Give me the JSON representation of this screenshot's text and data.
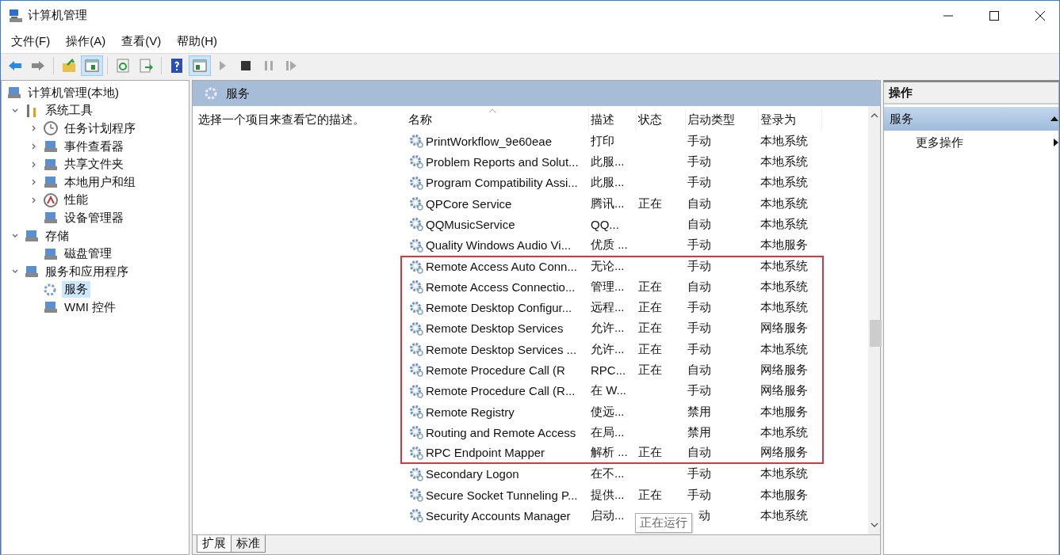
{
  "window": {
    "title": "计算机管理"
  },
  "menu": [
    "文件(F)",
    "操作(A)",
    "查看(V)",
    "帮助(H)"
  ],
  "toolbar": [
    {
      "kind": "back",
      "pressed": false,
      "disabled": false
    },
    {
      "kind": "forward",
      "pressed": false,
      "disabled": false
    },
    {
      "kind": "sep"
    },
    {
      "kind": "up",
      "pressed": false,
      "disabled": false
    },
    {
      "kind": "tree",
      "pressed": true,
      "disabled": false
    },
    {
      "kind": "sep"
    },
    {
      "kind": "refresh",
      "pressed": false,
      "disabled": false
    },
    {
      "kind": "export",
      "pressed": false,
      "disabled": false
    },
    {
      "kind": "sep"
    },
    {
      "kind": "help",
      "pressed": false,
      "disabled": false
    },
    {
      "kind": "pane",
      "pressed": true,
      "disabled": false
    },
    {
      "kind": "play",
      "pressed": false,
      "disabled": true
    },
    {
      "kind": "stop",
      "pressed": false,
      "disabled": false
    },
    {
      "kind": "pause",
      "pressed": false,
      "disabled": true
    },
    {
      "kind": "resume",
      "pressed": false,
      "disabled": true
    }
  ],
  "tree": [
    {
      "label": "计算机管理(本地)",
      "selected": false,
      "children": [
        {
          "label": "系统工具",
          "selected": false,
          "expanded": true,
          "children": [
            {
              "label": "任务计划程序",
              "selected": false,
              "expanded": false
            },
            {
              "label": "事件查看器",
              "selected": false,
              "expanded": false
            },
            {
              "label": "共享文件夹",
              "selected": false,
              "expanded": false
            },
            {
              "label": "本地用户和组",
              "selected": false,
              "expanded": false
            },
            {
              "label": "性能",
              "selected": false,
              "expanded": false
            },
            {
              "label": "设备管理器",
              "selected": false
            }
          ]
        },
        {
          "label": "存储",
          "selected": false,
          "expanded": true,
          "children": [
            {
              "label": "磁盘管理",
              "selected": false
            }
          ]
        },
        {
          "label": "服务和应用程序",
          "selected": false,
          "expanded": true,
          "children": [
            {
              "label": "服务",
              "selected": true
            },
            {
              "label": "WMI 控件",
              "selected": false
            }
          ]
        }
      ]
    }
  ],
  "center": {
    "title": "服务",
    "description": "选择一个项目来查看它的描述。",
    "columns": [
      "名称",
      "描述",
      "状态",
      "启动类型",
      "登录为"
    ],
    "rows": [
      {
        "name": "PrintWorkflow_9e60eae",
        "description": "打印",
        "status": "",
        "startup": "手动",
        "logon": "本地系统",
        "highlighted": false
      },
      {
        "name": "Problem Reports and Solut...",
        "description": "此服...",
        "status": "",
        "startup": "手动",
        "logon": "本地系统",
        "highlighted": false
      },
      {
        "name": "Program Compatibility Assi...",
        "description": "此服...",
        "status": "",
        "startup": "手动",
        "logon": "本地系统",
        "highlighted": false
      },
      {
        "name": "QPCore Service",
        "description": "腾讯...",
        "status": "正在",
        "startup": "自动",
        "logon": "本地系统",
        "highlighted": false
      },
      {
        "name": "QQMusicService",
        "description": "QQ...",
        "status": "",
        "startup": "自动",
        "logon": "本地系统",
        "highlighted": false
      },
      {
        "name": "Quality Windows Audio Vi...",
        "description": "优质 ...",
        "status": "",
        "startup": "手动",
        "logon": "本地服务",
        "highlighted": false
      },
      {
        "name": "Remote Access Auto Conn...",
        "description": "无论...",
        "status": "",
        "startup": "手动",
        "logon": "本地系统",
        "highlighted": true
      },
      {
        "name": "Remote Access Connectio...",
        "description": "管理...",
        "status": "正在",
        "startup": "自动",
        "logon": "本地系统",
        "highlighted": true
      },
      {
        "name": "Remote Desktop Configur...",
        "description": "远程...",
        "status": "正在",
        "startup": "手动",
        "logon": "本地系统",
        "highlighted": true
      },
      {
        "name": "Remote Desktop Services",
        "description": "允许...",
        "status": "正在",
        "startup": "手动",
        "logon": "网络服务",
        "highlighted": true
      },
      {
        "name": "Remote Desktop Services ...",
        "description": "允许...",
        "status": "正在",
        "startup": "手动",
        "logon": "本地系统",
        "highlighted": true
      },
      {
        "name": "Remote Procedure Call (R",
        "description": "RPC...",
        "status": "正在",
        "startup": "自动",
        "logon": "网络服务",
        "highlighted": true
      },
      {
        "name": "Remote Procedure Call (R...",
        "description": "在 W...",
        "status": "",
        "startup": "手动",
        "logon": "网络服务",
        "highlighted": true
      },
      {
        "name": "Remote Registry",
        "description": "使远...",
        "status": "",
        "startup": "禁用",
        "logon": "本地服务",
        "highlighted": true
      },
      {
        "name": "Routing and Remote Access",
        "description": "在局...",
        "status": "",
        "startup": "禁用",
        "logon": "本地系统",
        "highlighted": true
      },
      {
        "name": "RPC Endpoint Mapper",
        "description": "解析 ...",
        "status": "正在",
        "startup": "自动",
        "logon": "网络服务",
        "highlighted": true
      },
      {
        "name": "Secondary Logon",
        "description": "在不...",
        "status": "",
        "startup": "手动",
        "logon": "本地系统",
        "highlighted": false
      },
      {
        "name": "Secure Socket Tunneling P...",
        "description": "提供...",
        "status": "正在",
        "startup": "手动",
        "logon": "本地服务",
        "highlighted": false
      },
      {
        "name": "Security Accounts Manager",
        "description": "启动...",
        "status": "",
        "startup": "动",
        "logon": "本地系统",
        "highlighted": false,
        "tooltip": "正在运行"
      }
    ],
    "tabs": [
      {
        "label": "扩展",
        "selected": true
      },
      {
        "label": "标准",
        "selected": false
      }
    ]
  },
  "actions": {
    "title": "操作",
    "section": "服务",
    "expanded": true,
    "items": [
      "更多操作"
    ]
  }
}
